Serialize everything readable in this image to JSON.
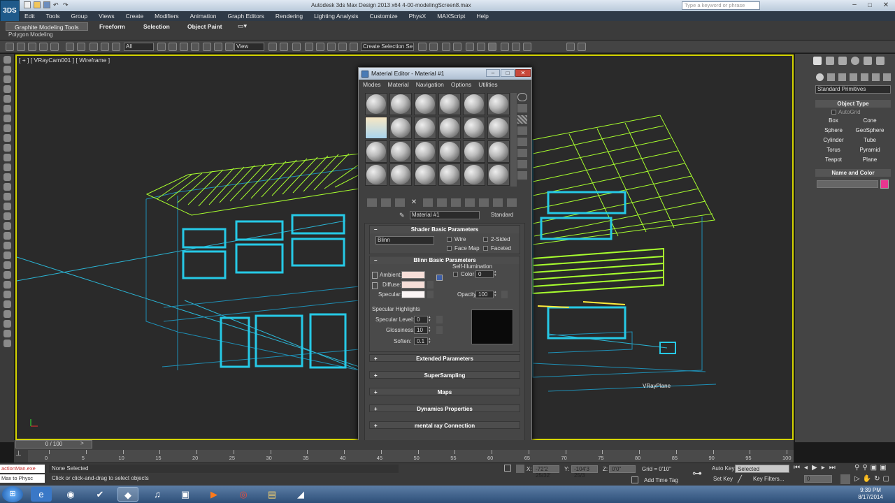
{
  "window": {
    "title": "Autodesk 3ds Max Design 2013 x64     4-00-modelingScreen8.max",
    "search_placeholder": "Type a keyword or phrase"
  },
  "app_logo": "3DS",
  "menu": [
    "Edit",
    "Tools",
    "Group",
    "Views",
    "Create",
    "Modifiers",
    "Animation",
    "Graph Editors",
    "Rendering",
    "Lighting Analysis",
    "Customize",
    "PhysX",
    "MAXScript",
    "Help"
  ],
  "ribbon": {
    "tabs": [
      "Graphite Modeling Tools",
      "Freeform",
      "Selection",
      "Object Paint"
    ],
    "sub_label": "Polygon Modeling"
  },
  "toolbar": {
    "filter_value": "All",
    "coord_value": "View",
    "selection_set_value": "Create Selection Se"
  },
  "viewport": {
    "label": "[ + ] [ VRayCam001 ] [ Wireframe ]",
    "vrayplane_label": "VRayPlane"
  },
  "material_editor": {
    "title": "Material Editor - Material #1",
    "menus": [
      "Modes",
      "Material",
      "Navigation",
      "Options",
      "Utilities"
    ],
    "material_name": "Material #1",
    "material_type": "Standard",
    "shader_section": "Shader Basic Parameters",
    "shader_value": "Blinn",
    "checks": [
      "Wire",
      "2-Sided",
      "Face Map",
      "Faceted"
    ],
    "blinn_section": "Blinn Basic Parameters",
    "self_illum_label": "Self-Illumination",
    "color_label": "Color",
    "color_value": "0",
    "ambient_label": "Ambient:",
    "diffuse_label": "Diffuse:",
    "specular_label": "Specular:",
    "opacity_label": "Opacity:",
    "opacity_value": "100",
    "spec_highlights_label": "Specular Highlights",
    "spec_level_label": "Specular Level:",
    "spec_level_value": "0",
    "glossiness_label": "Glossiness:",
    "glossiness_value": "10",
    "soften_label": "Soften:",
    "soften_value": "0.1",
    "rollouts": [
      "Extended Parameters",
      "SuperSampling",
      "Maps",
      "Dynamics Properties",
      "mental ray Connection"
    ]
  },
  "command_panel": {
    "dropdown_value": "Standard Primitives",
    "object_type_title": "Object Type",
    "autogrid_label": "AutoGrid",
    "buttons": [
      "Box",
      "Cone",
      "Sphere",
      "GeoSphere",
      "Cylinder",
      "Tube",
      "Torus",
      "Pyramid",
      "Teapot",
      "Plane"
    ],
    "name_color_title": "Name and Color",
    "swatch_color": "#e8358f"
  },
  "timeline": {
    "frame_label": "0 / 100",
    "ticks": [
      "0",
      "5",
      "10",
      "15",
      "20",
      "25",
      "30",
      "35",
      "40",
      "45",
      "50",
      "55",
      "60",
      "65",
      "70",
      "75",
      "80",
      "85",
      "90",
      "95",
      "100"
    ]
  },
  "status": {
    "script_lines": [
      "actionMan.exe",
      "Max to Physc"
    ],
    "selection_text": "None Selected",
    "prompt_text": "Click or click-and-drag to select objects",
    "x_label": "X:",
    "x_value": "-72'2 25/32'",
    "y_label": "Y:",
    "y_value": "-104'3 25/3",
    "z_label": "Z:",
    "z_value": "0'0\"",
    "grid_text": "Grid = 0'10\"",
    "add_time_tag": "Add Time Tag",
    "auto_key": "Auto Key",
    "selected_value": "Selected",
    "set_key": "Set Key",
    "key_filters": "Key Filters...",
    "frame_value": "0"
  },
  "taskbar": {
    "time": "9:39 PM",
    "date": "8/17/2014"
  }
}
